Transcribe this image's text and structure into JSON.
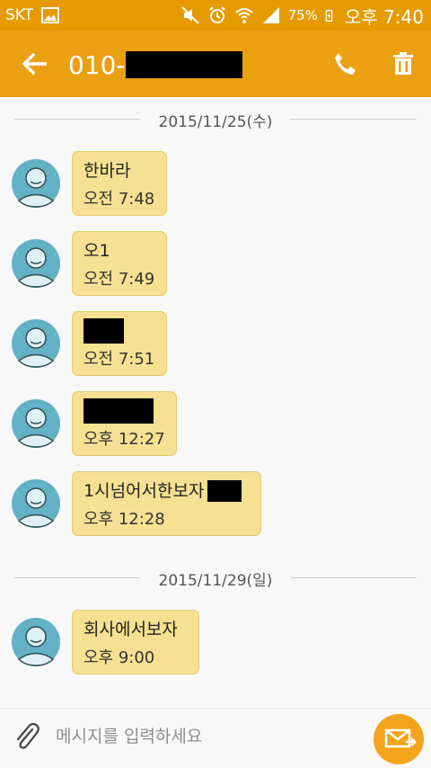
{
  "status_bar": {
    "carrier": "SKT",
    "battery": "75%",
    "time": "오후 7:40"
  },
  "toolbar": {
    "title_prefix": "010-"
  },
  "dates": [
    "2015/11/25(수)",
    "2015/11/29(일)"
  ],
  "messages": [
    {
      "text": "한바라",
      "time": "오전 7:48"
    },
    {
      "text": "오1",
      "time": "오전 7:49"
    },
    {
      "text": "",
      "time": "오전 7:51"
    },
    {
      "text": "",
      "time": "오후 12:27"
    },
    {
      "text": "1시넘어서한보자",
      "time": "오후 12:28"
    },
    {
      "text": "회사에서보자",
      "time": "오후 9:00"
    }
  ],
  "composer": {
    "placeholder": "메시지를 입력하세요"
  },
  "colors": {
    "status": "#e59a00",
    "toolbar": "#eba012",
    "bubble": "#f6e192",
    "send": "#f2a41b"
  }
}
